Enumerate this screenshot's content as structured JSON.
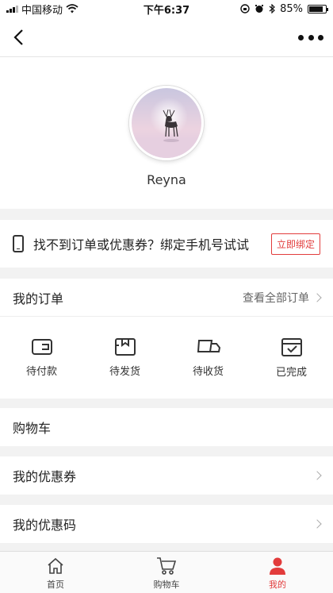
{
  "status_bar": {
    "carrier": "中国移动",
    "time": "下午6:37",
    "battery": "85%",
    "battery_level": 0.85
  },
  "profile": {
    "username": "Reyna"
  },
  "bind_bar": {
    "text": "找不到订单或优惠券？绑定手机号试试",
    "button": "立即绑定"
  },
  "orders": {
    "title": "我的订单",
    "view_all": "查看全部订单",
    "items": [
      {
        "label": "待付款",
        "icon": "wallet-icon"
      },
      {
        "label": "待发货",
        "icon": "box-icon"
      },
      {
        "label": "待收货",
        "icon": "truck-icon"
      },
      {
        "label": "已完成",
        "icon": "calendar-check-icon"
      }
    ]
  },
  "rows": [
    {
      "label": "购物车"
    },
    {
      "label": "我的优惠券"
    },
    {
      "label": "我的优惠码"
    }
  ],
  "tab_bar": {
    "items": [
      {
        "label": "首页",
        "icon": "home-icon"
      },
      {
        "label": "购物车",
        "icon": "cart-icon"
      },
      {
        "label": "我的",
        "icon": "person-icon",
        "active": true
      }
    ],
    "active_color": "#e23c3c"
  }
}
